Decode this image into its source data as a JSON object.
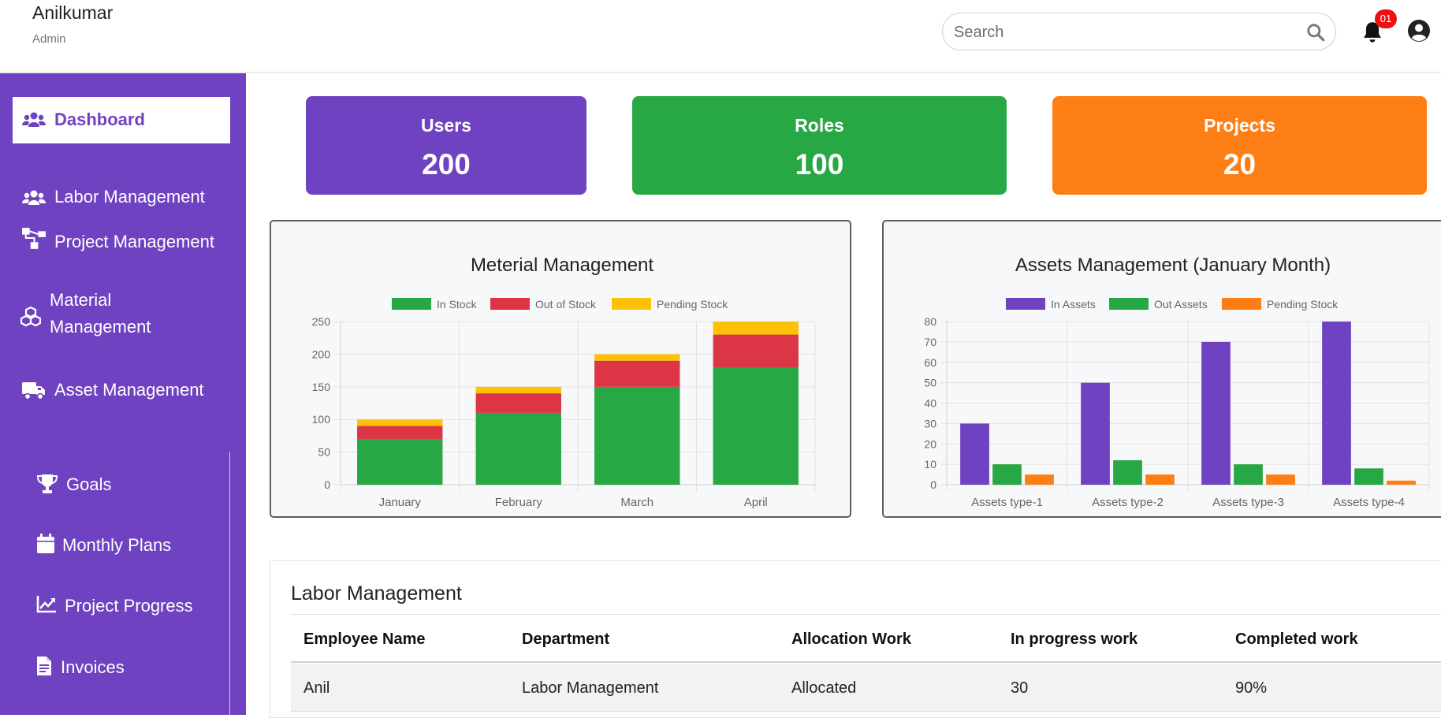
{
  "header": {
    "user_name": "Anilkumar",
    "user_role": "Admin",
    "search_placeholder": "Search",
    "notification_count": "01"
  },
  "sidebar": {
    "items": [
      {
        "label": "Dashboard",
        "icon": "users-icon",
        "active": true
      },
      {
        "label": "Labor Management",
        "icon": "users-icon"
      },
      {
        "label": "Project Management",
        "icon": "sitemap-icon"
      },
      {
        "label": "Material Management",
        "label_line1": "Material",
        "label_line2": "Management",
        "icon": "cubes-icon"
      },
      {
        "label": "Asset Management",
        "icon": "truck-icon"
      },
      {
        "label": "Goals",
        "icon": "trophy-icon"
      },
      {
        "label": "Monthly Plans",
        "icon": "calendar-icon"
      },
      {
        "label": "Project Progress",
        "icon": "chart-line-icon"
      },
      {
        "label": "Invoices",
        "icon": "file-invoice-icon"
      }
    ]
  },
  "stats": [
    {
      "title": "Users",
      "value": "200",
      "color": "#6f42c1"
    },
    {
      "title": "Roles",
      "value": "100",
      "color": "#28a745"
    },
    {
      "title": "Projects",
      "value": "20",
      "color": "#fd7e14"
    }
  ],
  "chart_data": [
    {
      "type": "bar",
      "stacked": true,
      "title": "Meterial Management",
      "legend_position": "top",
      "grid": true,
      "categories": [
        "January",
        "February",
        "March",
        "April"
      ],
      "ylim": [
        0,
        250
      ],
      "yticks": [
        0,
        50,
        100,
        150,
        200,
        250
      ],
      "series": [
        {
          "name": "In Stock",
          "color": "#28a745",
          "values": [
            70,
            110,
            150,
            180
          ]
        },
        {
          "name": "Out of Stock",
          "color": "#dc3545",
          "values": [
            20,
            30,
            40,
            50
          ]
        },
        {
          "name": "Pending Stock",
          "color": "#ffc107",
          "values": [
            10,
            10,
            10,
            20
          ]
        }
      ]
    },
    {
      "type": "bar",
      "stacked": false,
      "title": "Assets Management (January Month)",
      "legend_position": "top",
      "grid": true,
      "categories": [
        "Assets type-1",
        "Assets type-2",
        "Assets type-3",
        "Assets type-4"
      ],
      "ylim": [
        0,
        80
      ],
      "yticks": [
        0,
        10,
        20,
        30,
        40,
        50,
        60,
        70,
        80
      ],
      "series": [
        {
          "name": "In Assets",
          "color": "#6f42c1",
          "values": [
            30,
            50,
            70,
            80
          ]
        },
        {
          "name": "Out Assets",
          "color": "#28a745",
          "values": [
            10,
            12,
            10,
            8
          ]
        },
        {
          "name": "Pending Stock",
          "color": "#fd7e14",
          "values": [
            5,
            5,
            5,
            2
          ]
        }
      ]
    }
  ],
  "labor_table": {
    "title": "Labor Management",
    "columns": [
      "Employee Name",
      "Department",
      "Allocation Work",
      "In progress work",
      "Completed work"
    ],
    "rows": [
      [
        "Anil",
        "Labor Management",
        "Allocated",
        "30",
        "90%"
      ]
    ]
  }
}
